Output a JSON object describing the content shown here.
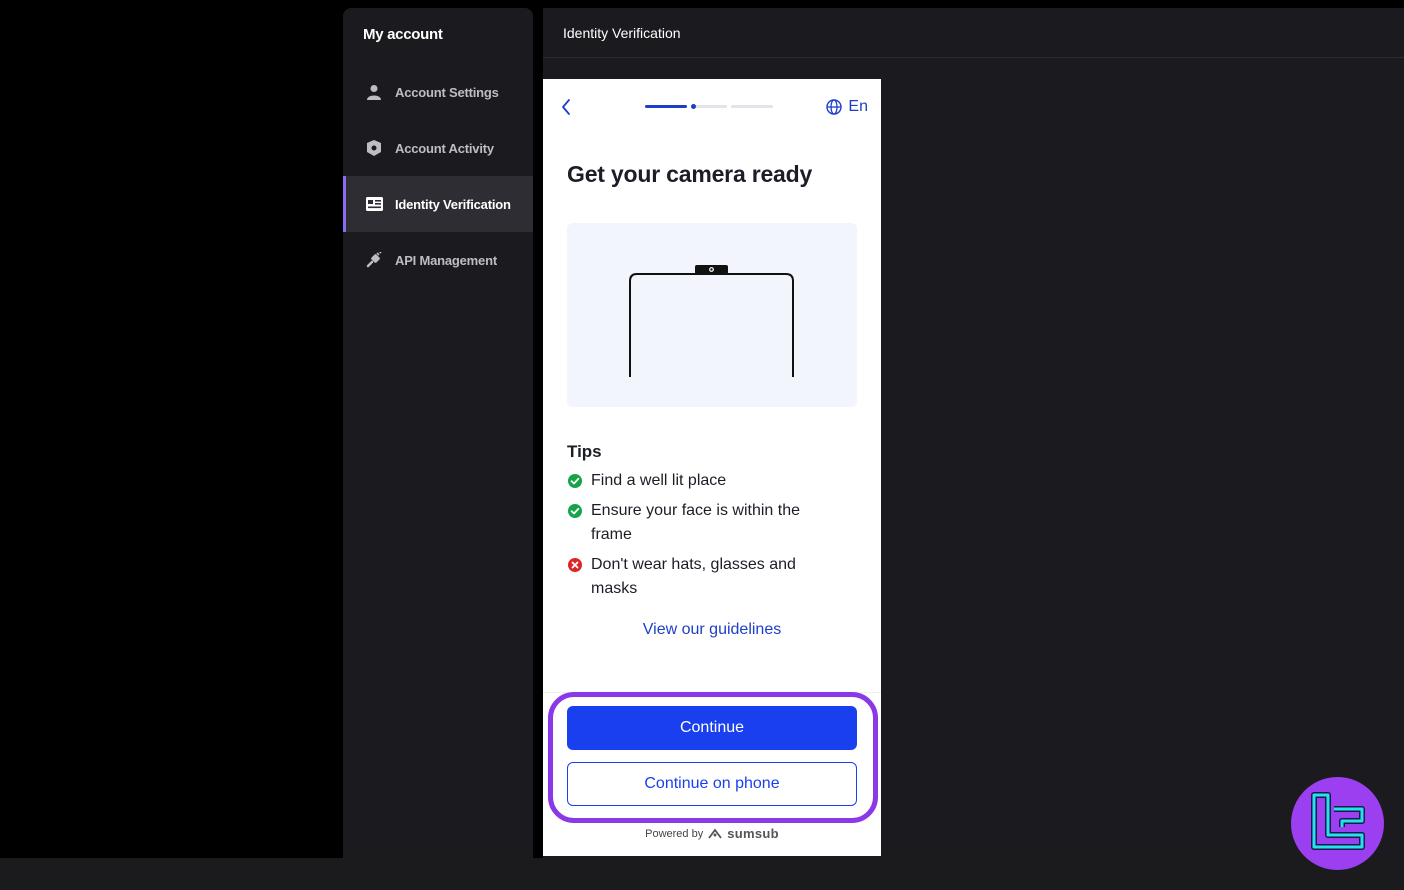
{
  "sidebar": {
    "title": "My account",
    "items": [
      {
        "label": "Account Settings",
        "icon": "user-icon"
      },
      {
        "label": "Account Activity",
        "icon": "shield-icon"
      },
      {
        "label": "Identity Verification",
        "icon": "id-card-icon",
        "active": true
      },
      {
        "label": "API Management",
        "icon": "plug-icon"
      }
    ],
    "active_accent": "#8a6cf0"
  },
  "main": {
    "header_title": "Identity Verification"
  },
  "widget": {
    "language": "En",
    "title": "Get your camera ready",
    "tips_heading": "Tips",
    "tips": [
      {
        "text": "Find a well lit place",
        "status": "ok"
      },
      {
        "text": "Ensure your face is within the frame",
        "status": "ok"
      },
      {
        "text": "Don't wear hats, glasses and masks",
        "status": "bad"
      }
    ],
    "guidelines_link": "View our guidelines",
    "continue_label": "Continue",
    "continue_phone_label": "Continue on phone",
    "powered_by": "Powered by",
    "powered_brand": "sumsub",
    "primary_color": "#1a3fef"
  }
}
